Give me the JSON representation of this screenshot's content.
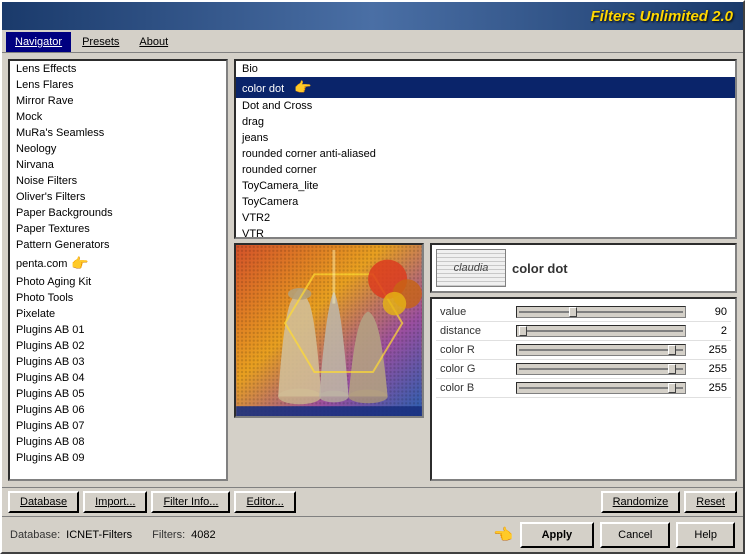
{
  "app": {
    "title": "Filters Unlimited 2.0"
  },
  "tabs": [
    {
      "label": "Navigator",
      "active": true
    },
    {
      "label": "Presets",
      "active": false
    },
    {
      "label": "About",
      "active": false
    }
  ],
  "navigator": {
    "categories": [
      {
        "label": "Lens Effects"
      },
      {
        "label": "Lens Flares"
      },
      {
        "label": "Mirror Rave",
        "hasArrow": false
      },
      {
        "label": "Mock"
      },
      {
        "label": "MuRa's Seamless"
      },
      {
        "label": "Neology"
      },
      {
        "label": "Nirvana"
      },
      {
        "label": "Noise Filters"
      },
      {
        "label": "Oliver's Filters"
      },
      {
        "label": "Paper Backgrounds"
      },
      {
        "label": "Paper Textures"
      },
      {
        "label": "Pattern Generators"
      },
      {
        "label": "penta.com",
        "hasArrow": true
      },
      {
        "label": "Photo Aging Kit"
      },
      {
        "label": "Photo Tools"
      },
      {
        "label": "Pixelate"
      },
      {
        "label": "Plugins AB 01"
      },
      {
        "label": "Plugins AB 02"
      },
      {
        "label": "Plugins AB 03"
      },
      {
        "label": "Plugins AB 04"
      },
      {
        "label": "Plugins AB 05"
      },
      {
        "label": "Plugins AB 06"
      },
      {
        "label": "Plugins AB 07"
      },
      {
        "label": "Plugins AB 08"
      },
      {
        "label": "Plugins AB 09"
      }
    ],
    "filters": [
      {
        "label": "Bio"
      },
      {
        "label": "color dot",
        "selected": true
      },
      {
        "label": "Dot and Cross"
      },
      {
        "label": "drag"
      },
      {
        "label": "jeans"
      },
      {
        "label": "rounded corner anti-aliased"
      },
      {
        "label": "rounded corner"
      },
      {
        "label": "ToyCamera_lite"
      },
      {
        "label": "ToyCamera"
      },
      {
        "label": "VTR2"
      },
      {
        "label": "VTR"
      }
    ],
    "selected_filter": "color dot",
    "plugin_logo_text": "claudia",
    "plugin_name": "color dot",
    "params": [
      {
        "label": "value",
        "value": 90,
        "min": 0,
        "max": 255,
        "pct": 0.35
      },
      {
        "label": "distance",
        "value": 2,
        "min": 0,
        "max": 255,
        "pct": 0.01
      },
      {
        "label": "color R",
        "value": 255,
        "min": 0,
        "max": 255,
        "pct": 1.0
      },
      {
        "label": "color G",
        "value": 255,
        "min": 0,
        "max": 255,
        "pct": 1.0
      },
      {
        "label": "color B",
        "value": 255,
        "min": 0,
        "max": 255,
        "pct": 1.0
      }
    ]
  },
  "toolbar": {
    "database_label": "Database",
    "import_label": "Import...",
    "filter_info_label": "Filter Info...",
    "editor_label": "Editor...",
    "randomize_label": "Randomize",
    "reset_label": "Reset"
  },
  "status": {
    "database_label": "Database:",
    "database_value": "ICNET-Filters",
    "filters_label": "Filters:",
    "filters_value": "4082"
  },
  "actions": {
    "apply_label": "Apply",
    "cancel_label": "Cancel",
    "help_label": "Help"
  }
}
